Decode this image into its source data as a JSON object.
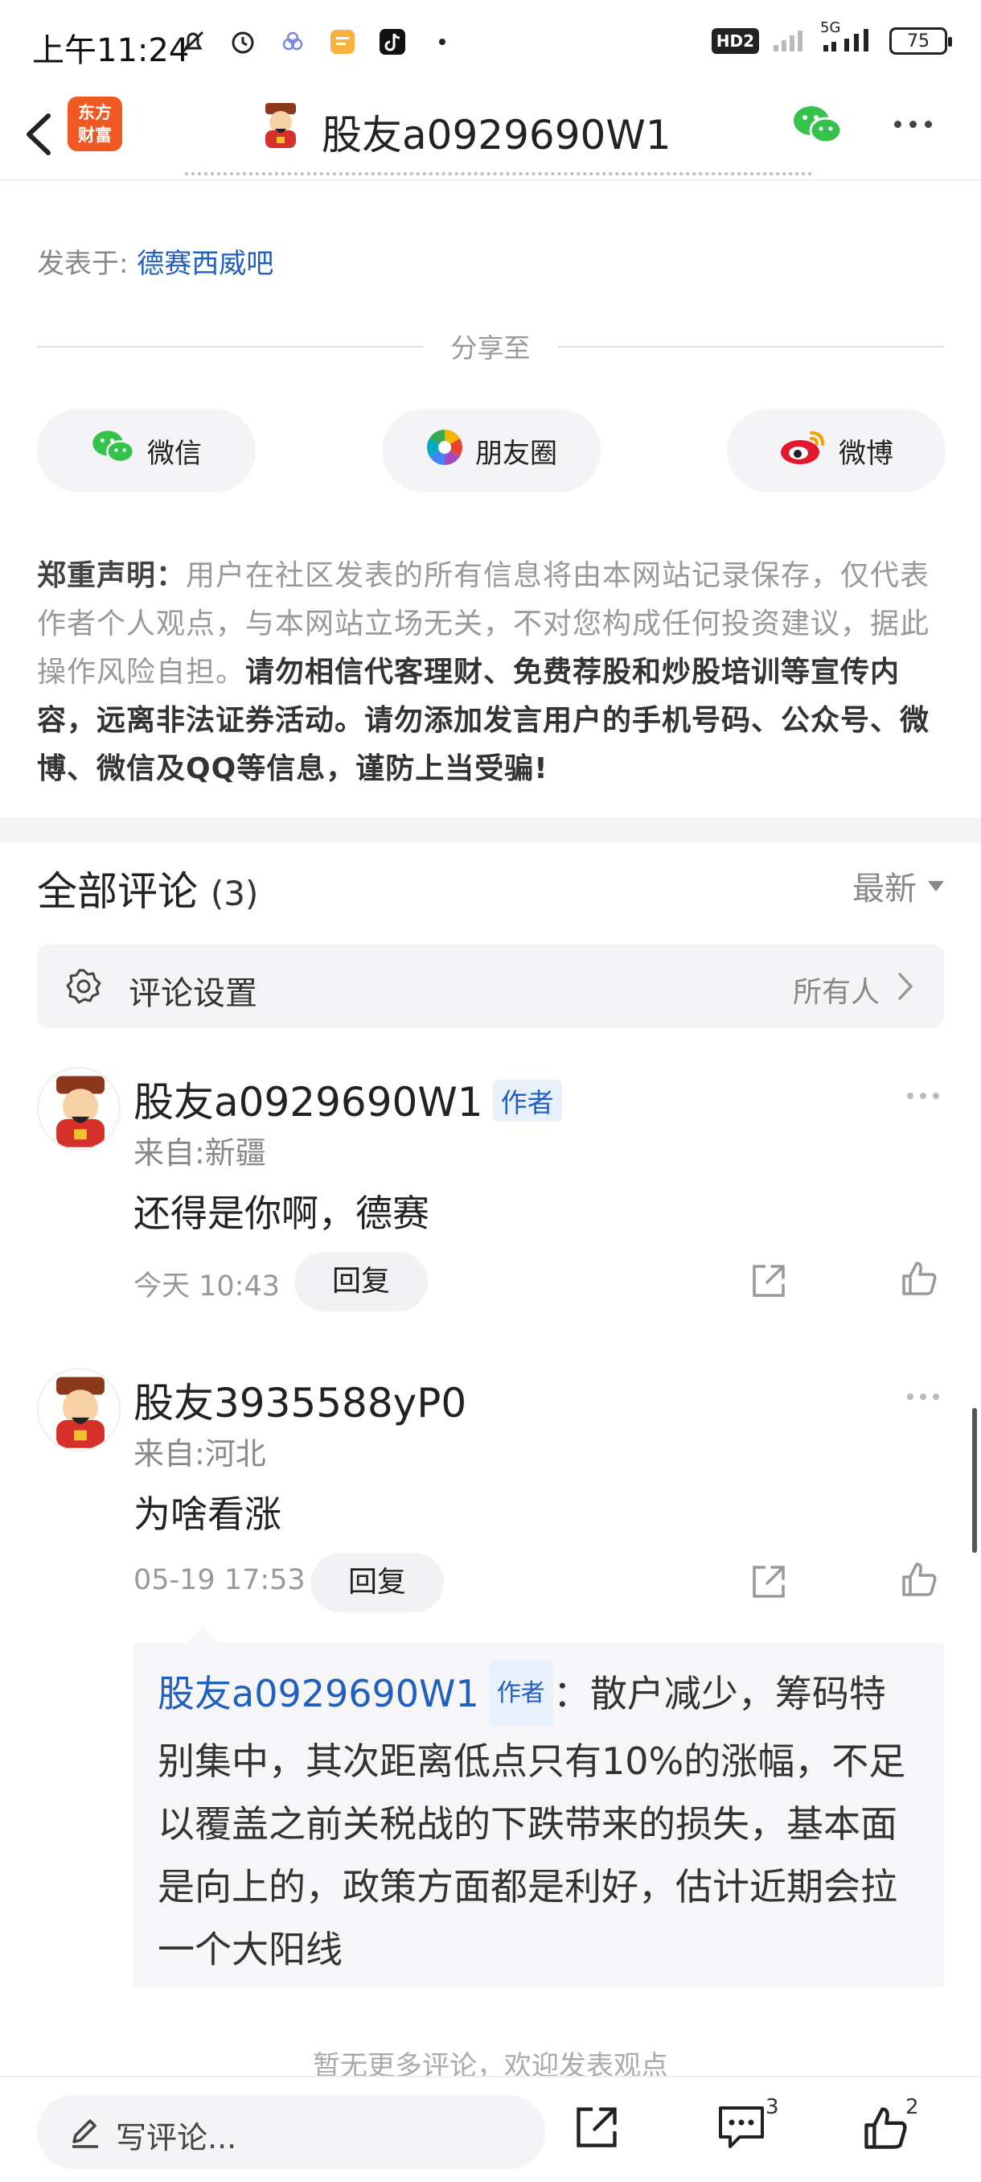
{
  "status_bar": {
    "time": "上午11:24",
    "network": "5G",
    "hd": "HD2",
    "battery": "75"
  },
  "nav": {
    "app_logo_line1": "东方",
    "app_logo_line2": "财富",
    "title": "股友a0929690W1"
  },
  "post": {
    "posted_in_label": "发表于: ",
    "bar_name": "德赛西威吧",
    "share_label": "分享至",
    "share_targets": [
      {
        "label": "微信",
        "icon": "wechat-icon"
      },
      {
        "label": "朋友圈",
        "icon": "moments-icon"
      },
      {
        "label": "微博",
        "icon": "weibo-icon"
      }
    ],
    "disclaimer_title": "郑重声明：",
    "disclaimer_text": "用户在社区发表的所有信息将由本网站记录保存，仅代表作者个人观点，与本网站立场无关，不对您构成任何投资建议，据此操作风险自担。",
    "disclaimer_strong": "请勿相信代客理财、免费荐股和炒股培训等宣传内容，远离非法证券活动。请勿添加发言用户的手机号码、公众号、微博、微信及QQ等信息，谨防上当受骗!"
  },
  "comments": {
    "title": "全部评论",
    "count": "(3)",
    "sort": "最新",
    "settings_label": "评论设置",
    "settings_value": "所有人",
    "author_tag": "作者",
    "reply_label": "回复",
    "items": [
      {
        "name": "股友a0929690W1",
        "is_author": true,
        "from": "来自:新疆",
        "body": "还得是你啊，德赛",
        "time": "今天 10:43"
      },
      {
        "name": "股友3935588yP0",
        "is_author": false,
        "from": "来自:河北",
        "body": "为啥看涨",
        "time": "05-19 17:53",
        "reply": {
          "name": "股友a0929690W1",
          "tag": "作者",
          "text": "：散户减少，筹码特别集中，其次距离低点只有10%的涨幅，不足以覆盖之前关税战的下跌带来的损失，基本面是向上的，政策方面都是利好，估计近期会拉一个大阳线"
        }
      }
    ],
    "no_more": "暂无更多评论，欢迎发表观点"
  },
  "bottom_bar": {
    "input_placeholder": "写评论...",
    "comment_count": "3",
    "like_count": "2"
  },
  "colors": {
    "link_blue": "#1e5fbf",
    "brand_orange": "#f05a22"
  }
}
